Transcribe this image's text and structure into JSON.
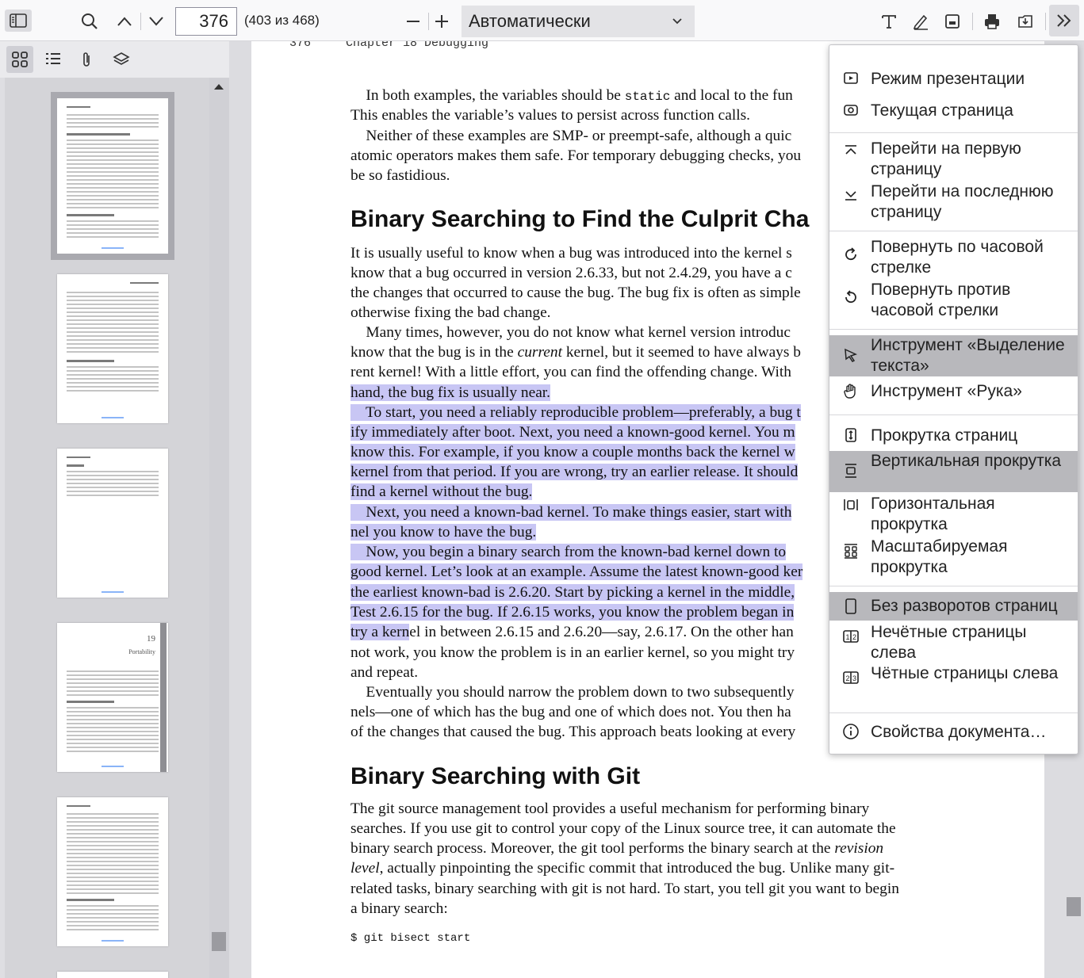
{
  "toolbar": {
    "page_number": "376",
    "page_count": "(403 из 468)",
    "zoom_value": "Автоматически"
  },
  "document": {
    "chapter_page": "376",
    "chapter_title": "Chapter 18  Debugging",
    "lines1": [
      [
        "In both examples, the variables should be ",
        "static",
        " and local to the fun"
      ],
      "This enables the variable’s values to persist across function calls.",
      "    Neither of these examples are SMP- or preempt-safe, although a quic",
      "atomic operators makes them safe. For temporary debugging checks, you",
      "be so fastidious."
    ],
    "heading1": "Binary Searching to Find the Culprit Cha",
    "para2": [
      "It is usually useful to know when a bug was introduced into the kernel s",
      "know that a bug occurred in version 2.6.33, but not 2.4.29, you have a c",
      "the changes that occurred to cause the bug. The bug fix is often as simple",
      "otherwise fixing the bad change.",
      "    Many times, however, you do not know what kernel version introduc",
      [
        "know that the bug is in the ",
        "current",
        " kernel, but it seemed to have always b"
      ],
      "rent kernel! With a little effort, you can find the offending change. With"
    ],
    "para2_hl": "hand, the bug fix is usually near.",
    "para3_hl": [
      "    To start, you need a reliably reproducible problem—preferably, a bug t",
      "ify immediately after boot. Next, you need a known-good kernel. You m",
      "know this. For example, if you know a couple months back the kernel w",
      "kernel from that period. If you are wrong, try an earlier release. It should",
      "find a kernel without the bug.",
      "    Next, you need a known-bad kernel. To make things easier, start with",
      "nel you know to have the bug.",
      "    Now, you begin a binary search from the known-bad kernel down to",
      "good kernel. Let’s look at an example. Assume the latest known-good ker",
      "the earliest known-bad is 2.6.20. Start by picking a kernel in the middle,",
      "Test 2.6.15 for the bug. If 2.6.15 works, you know the problem began in"
    ],
    "line_split_hl": "try a kern",
    "line_split_rest": "el in between 2.6.15 and 2.6.20—say, 2.6.17. On the other han",
    "para4": [
      "not work, you know the problem is in an earlier kernel, so you might try",
      "and repeat.",
      "    Eventually you should narrow the problem down to two subsequently",
      "nels—one of which has the bug and one of which does not. You then ha",
      "of the changes that caused the bug. This approach beats looking at every"
    ],
    "heading2": "Binary Searching with Git",
    "para5": [
      "The git source management tool provides a useful mechanism for performing binary",
      "searches. If you use git to control your copy of the Linux source tree, it can automate the",
      [
        "binary search process. Moreover, the git tool performs the binary search at the ",
        "revision",
        ""
      ],
      [
        "",
        "level",
        ", actually pinpointing the specific commit that introduced the bug. Unlike many git-"
      ],
      "related tasks, binary searching with git is not hard. To start, you tell git you want to begin",
      "a binary search:"
    ],
    "code": "$ git bisect start"
  },
  "thumbnails": {
    "page4_num": "19",
    "page4_title": "Portability"
  },
  "menu": {
    "items": [
      {
        "label": "Режим презентации",
        "icon": "presentation-icon"
      },
      {
        "label": "Текущая страница",
        "icon": "current-page-icon"
      },
      {
        "label": "Перейти на первую страницу",
        "icon": "first-page-icon"
      },
      {
        "label": "Перейти на последнюю страницу",
        "icon": "last-page-icon"
      },
      {
        "label": "Повернуть по часовой стрелке",
        "icon": "rotate-cw-icon"
      },
      {
        "label": "Повернуть против часовой стрелки",
        "icon": "rotate-ccw-icon"
      },
      {
        "label": "Инструмент «Выделение текста»",
        "icon": "text-select-icon"
      },
      {
        "label": "Инструмент «Рука»",
        "icon": "hand-tool-icon"
      },
      {
        "label": "Прокрутка страниц",
        "icon": "page-scroll-icon"
      },
      {
        "label": "Вертикальная прокрутка",
        "icon": "vertical-scroll-icon"
      },
      {
        "label": "Горизонтальная прокрутка",
        "icon": "horizontal-scroll-icon"
      },
      {
        "label": "Масштабируемая прокрутка",
        "icon": "wrapped-scroll-icon"
      },
      {
        "label": "Без разворотов страниц",
        "icon": "no-spreads-icon"
      },
      {
        "label": "Нечётные страницы слева",
        "icon": "odd-spreads-icon"
      },
      {
        "label": "Чётные страницы слева",
        "icon": "even-spreads-icon"
      },
      {
        "label": "Свойства документа…",
        "icon": "info-icon"
      }
    ]
  }
}
